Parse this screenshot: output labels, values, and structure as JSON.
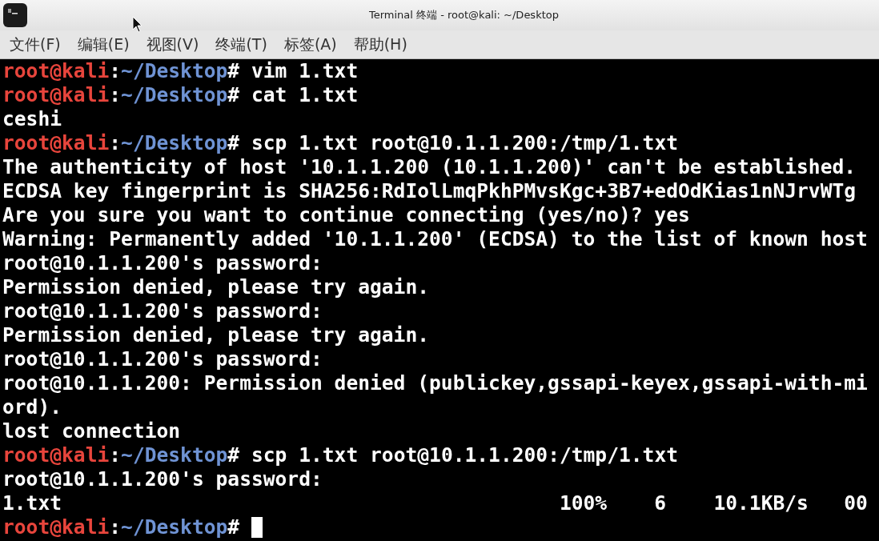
{
  "window": {
    "title": "Terminal 终端 - root@kali: ~/Desktop"
  },
  "menu": [
    "文件(F)",
    "编辑(E)",
    "视图(V)",
    "终端(T)",
    "标签(A)",
    "帮助(H)"
  ],
  "lines": [
    {
      "kind": "prompt",
      "user": "root@kali",
      "separator": ":",
      "path": "~/Desktop",
      "symbol": "#",
      "command": "vim 1.txt"
    },
    {
      "kind": "prompt",
      "user": "root@kali",
      "separator": ":",
      "path": "~/Desktop",
      "symbol": "#",
      "command": "cat 1.txt"
    },
    {
      "kind": "output",
      "text": "ceshi"
    },
    {
      "kind": "prompt",
      "user": "root@kali",
      "separator": ":",
      "path": "~/Desktop",
      "symbol": "#",
      "command": "scp 1.txt root@10.1.1.200:/tmp/1.txt"
    },
    {
      "kind": "output",
      "text": "The authenticity of host '10.1.1.200 (10.1.1.200)' can't be established."
    },
    {
      "kind": "output",
      "text": "ECDSA key fingerprint is SHA256:RdIolLmqPkhPMvsKgc+3B7+edOdKias1nNJrvWTg"
    },
    {
      "kind": "output",
      "text": "Are you sure you want to continue connecting (yes/no)? yes"
    },
    {
      "kind": "output",
      "text": "Warning: Permanently added '10.1.1.200' (ECDSA) to the list of known host"
    },
    {
      "kind": "output",
      "text": "root@10.1.1.200's password:"
    },
    {
      "kind": "output",
      "text": "Permission denied, please try again."
    },
    {
      "kind": "output",
      "text": "root@10.1.1.200's password:"
    },
    {
      "kind": "output",
      "text": "Permission denied, please try again."
    },
    {
      "kind": "output",
      "text": "root@10.1.1.200's password:"
    },
    {
      "kind": "output",
      "text": "root@10.1.1.200: Permission denied (publickey,gssapi-keyex,gssapi-with-mi"
    },
    {
      "kind": "output",
      "text": "ord)."
    },
    {
      "kind": "output",
      "text": "lost connection"
    },
    {
      "kind": "prompt",
      "user": "root@kali",
      "separator": ":",
      "path": "~/Desktop",
      "symbol": "#",
      "command": "scp 1.txt root@10.1.1.200:/tmp/1.txt"
    },
    {
      "kind": "output",
      "text": "root@10.1.1.200's password:"
    },
    {
      "kind": "output",
      "text": "1.txt                                          100%    6    10.1KB/s   00"
    },
    {
      "kind": "prompt",
      "user": "root@kali",
      "separator": ":",
      "path": "~/Desktop",
      "symbol": "#",
      "cursor": true
    }
  ]
}
